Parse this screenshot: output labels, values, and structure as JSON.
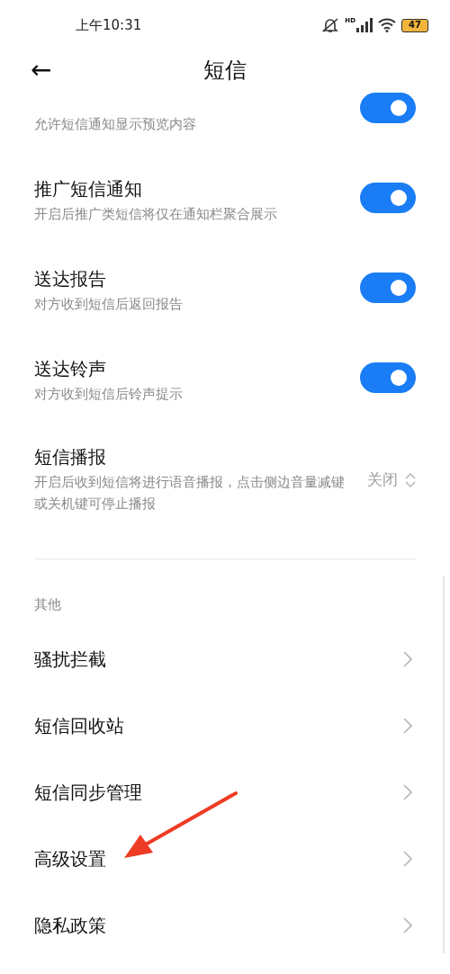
{
  "status_bar": {
    "time": "上午10:31",
    "network": "HD",
    "battery": "47"
  },
  "header": {
    "back": "←",
    "title": "短信"
  },
  "toggles": [
    {
      "subtitle": "允许短信通知显示预览内容",
      "on": true
    },
    {
      "title": "推广短信通知",
      "subtitle": "开启后推广类短信将仅在通知栏聚合展示",
      "on": true
    },
    {
      "title": "送达报告",
      "subtitle": "对方收到短信后返回报告",
      "on": true
    },
    {
      "title": "送达铃声",
      "subtitle": "对方收到短信后铃声提示",
      "on": true
    }
  ],
  "broadcast": {
    "title": "短信播报",
    "subtitle": "开启后收到短信将进行语音播报，点击侧边音量减键或关机键可停止播报",
    "value": "关闭"
  },
  "section": {
    "title": "其他",
    "items": [
      "骚扰拦截",
      "短信回收站",
      "短信同步管理",
      "高级设置",
      "隐私政策"
    ]
  }
}
